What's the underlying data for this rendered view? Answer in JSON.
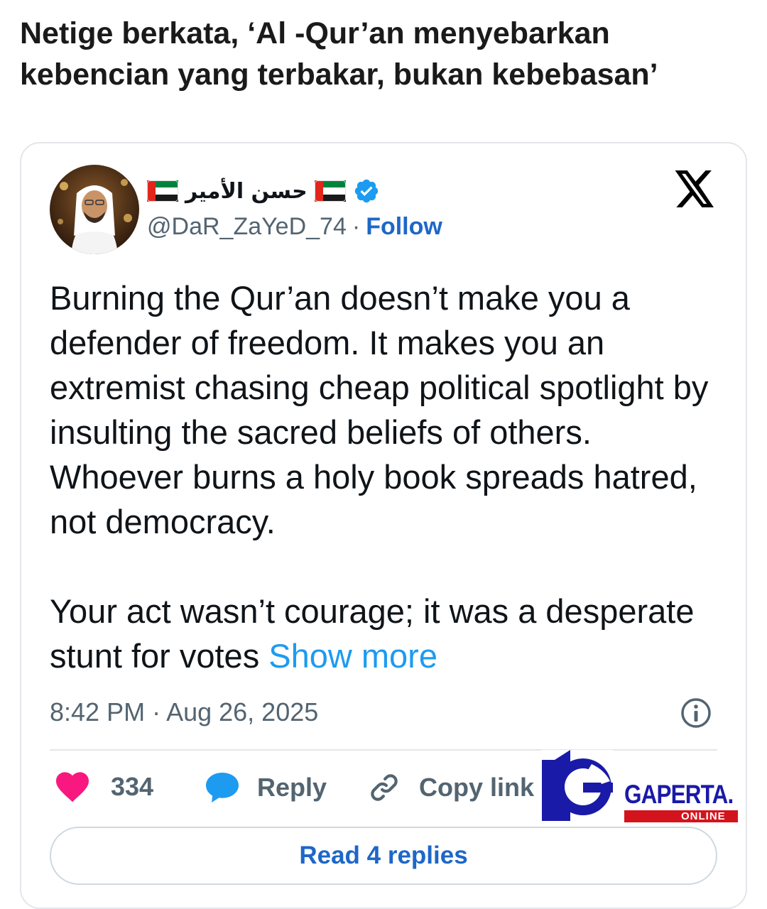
{
  "headline": "Netige berkata, ‘Al -Qur’an menyebarkan kebencian yang terbakar, bukan kebebasan’",
  "tweet": {
    "display_name": "حسن الأمير",
    "handle": "@DaR_ZaYeD_74",
    "separator": "·",
    "follow_label": "Follow",
    "text_paragraph_1": "Burning the Qur’an doesn’t make you a defender of freedom. It makes you an extremist chasing cheap political spotlight by insulting the sacred beliefs of others. Whoever burns a holy book spreads hatred, not democracy.",
    "text_paragraph_2": "Your act wasn’t courage; it was a desperate stunt for votes",
    "show_more_label": "Show more",
    "timestamp": "8:42 PM · Aug 26, 2025",
    "like_count": "334",
    "reply_label": "Reply",
    "copy_link_label": "Copy link",
    "read_replies_label": "Read 4 replies"
  },
  "watermark": {
    "brand": "GAPERTA.",
    "sub": "ONLINE"
  },
  "colors": {
    "link_blue": "#1d67c8",
    "show_more_blue": "#1d9bf0",
    "like_pink": "#f91880",
    "reply_blue": "#1d9bf0",
    "verified_blue": "#1d9bf0",
    "muted_gray": "#536471"
  },
  "icons": [
    "uae-flag-icon",
    "verified-badge-icon",
    "x-logo-icon",
    "info-icon",
    "heart-icon",
    "reply-bubble-icon",
    "link-icon"
  ]
}
